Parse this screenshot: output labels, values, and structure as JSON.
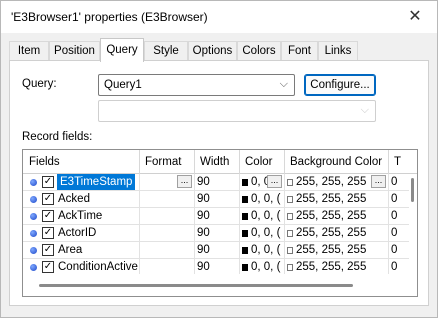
{
  "window": {
    "title": "'E3Browser1' properties (E3Browser)",
    "close_label": "✕"
  },
  "tabs": [
    "Item",
    "Position",
    "Query",
    "Style",
    "Options",
    "Colors",
    "Font",
    "Links"
  ],
  "active_tab": "Query",
  "query": {
    "label": "Query:",
    "selected": "Query1",
    "configure_label": "Configure...",
    "second_selected": ""
  },
  "record_fields_label": "Record fields:",
  "grid": {
    "columns": [
      "Fields",
      "Format",
      "Width",
      "Color",
      "Background Color",
      "T"
    ],
    "rows": [
      {
        "field": "E3TimeStamp",
        "checked": true,
        "width": "90",
        "color": "0, 0, (",
        "bg": "255, 255, 255",
        "t": "0"
      },
      {
        "field": "Acked",
        "checked": true,
        "width": "90",
        "color": "0, 0, (",
        "bg": "255, 255, 255",
        "t": "0"
      },
      {
        "field": "AckTime",
        "checked": true,
        "width": "90",
        "color": "0, 0, (",
        "bg": "255, 255, 255",
        "t": "0"
      },
      {
        "field": "ActorID",
        "checked": true,
        "width": "90",
        "color": "0, 0, (",
        "bg": "255, 255, 255",
        "t": "0"
      },
      {
        "field": "Area",
        "checked": true,
        "width": "90",
        "color": "0, 0, (",
        "bg": "255, 255, 255",
        "t": "0"
      },
      {
        "field": "ConditionActive",
        "checked": true,
        "width": "90",
        "color": "0, 0, (",
        "bg": "255, 255, 255",
        "t": "0"
      }
    ],
    "ellipsis": "...",
    "check_mark": "✓"
  },
  "colors": {
    "selection": "#0078d7",
    "accent": "#0067c0",
    "bullet": "#1d48c8"
  }
}
